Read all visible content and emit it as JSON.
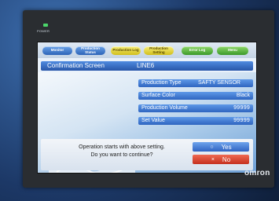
{
  "device": {
    "power_label": "POWER",
    "brand": "omron"
  },
  "tabs": [
    {
      "label": "Monitor",
      "color": "blue"
    },
    {
      "label": "Production Status",
      "color": "blue"
    },
    {
      "label": "Production Log",
      "color": "yellow"
    },
    {
      "label": "Production Setting",
      "color": "yellow"
    },
    {
      "label": "Error Log",
      "color": "green"
    },
    {
      "label": "Menu",
      "color": "green"
    }
  ],
  "title": {
    "screen": "Confirmation Screen",
    "line": "LINE6"
  },
  "fields": [
    {
      "label": "Production Type",
      "value": "SAFTY SENSOR"
    },
    {
      "label": "Surface Color",
      "value": "Black"
    },
    {
      "label": "Production Volume",
      "value": "99999"
    },
    {
      "label": "Set Value",
      "value": "99999"
    }
  ],
  "dialog": {
    "line1": "Operation starts with above setting.",
    "line2": "Do you want to continue?",
    "yes": "Yes",
    "no": "No"
  },
  "colors": {
    "accent_blue": "#2f63c2",
    "danger_red": "#c5301e",
    "led_green": "#4bd66a"
  }
}
